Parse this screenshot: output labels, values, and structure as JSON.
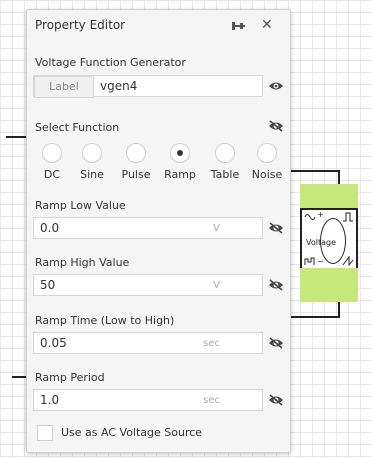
{
  "panel": {
    "title": "Property Editor",
    "header_icons": [
      "pin-icon",
      "close-icon"
    ]
  },
  "component": {
    "name": "Voltage",
    "plus": "+",
    "minus": "−"
  },
  "generator": {
    "section_title": "Voltage Function Generator",
    "label_chip": "Label",
    "label_value": "vgen4"
  },
  "function": {
    "section_title": "Select Function",
    "options": [
      "DC",
      "Sine",
      "Pulse",
      "Ramp",
      "Table",
      "Noise"
    ],
    "selected": "Ramp"
  },
  "ramp_low": {
    "label": "Ramp Low Value",
    "value": "0.0",
    "unit": "V"
  },
  "ramp_high": {
    "label": "Ramp High Value",
    "value": "50",
    "unit": "V"
  },
  "ramp_time": {
    "label": "Ramp Time (Low to High)",
    "value": "0.05",
    "unit": "sec"
  },
  "ramp_period": {
    "label": "Ramp Period",
    "value": "1.0",
    "unit": "sec"
  },
  "ac_source": {
    "label": "Use as AC Voltage Source",
    "checked": false
  },
  "colors": {
    "component_fill": "#c6e77a",
    "panel_bg": "#f5f5f5"
  }
}
